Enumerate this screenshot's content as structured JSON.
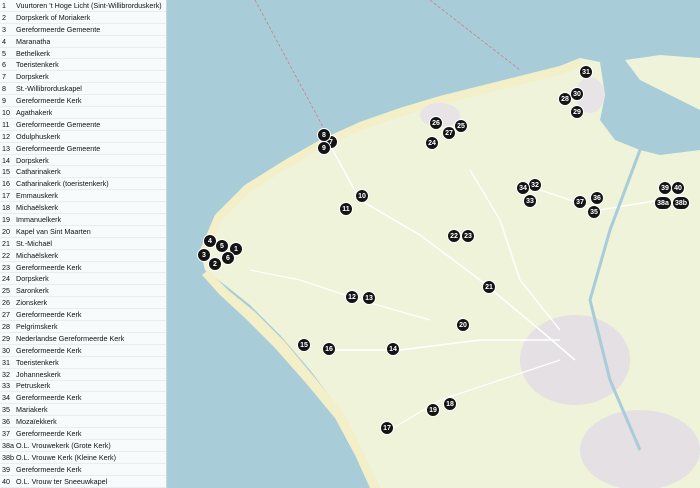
{
  "legend": [
    {
      "num": "1",
      "name": "Vuurtoren 't Hoge Licht (Sint-Willibrorduskerk)"
    },
    {
      "num": "2",
      "name": "Dorpskerk of Moriakerk"
    },
    {
      "num": "3",
      "name": "Gereformeerde Gemeente"
    },
    {
      "num": "4",
      "name": "Maranatha"
    },
    {
      "num": "5",
      "name": "Bethelkerk"
    },
    {
      "num": "6",
      "name": "Toeristenkerk"
    },
    {
      "num": "7",
      "name": "Dorpskerk"
    },
    {
      "num": "8",
      "name": "St.-Willibrorduskapel"
    },
    {
      "num": "9",
      "name": "Gereformeerde Kerk"
    },
    {
      "num": "10",
      "name": "Agathakerk"
    },
    {
      "num": "11",
      "name": "Gereformeerde Gemeente"
    },
    {
      "num": "12",
      "name": "Odulphuskerk"
    },
    {
      "num": "13",
      "name": "Gereformeerde Gemeente"
    },
    {
      "num": "14",
      "name": "Dorpskerk"
    },
    {
      "num": "15",
      "name": "Catharinakerk"
    },
    {
      "num": "16",
      "name": "Catharinakerk (toeristenkerk)"
    },
    {
      "num": "17",
      "name": "Emmauskerk"
    },
    {
      "num": "18",
      "name": "Michaëlskerk"
    },
    {
      "num": "19",
      "name": "Immanuelkerk"
    },
    {
      "num": "20",
      "name": "Kapel van Sint Maarten"
    },
    {
      "num": "21",
      "name": "St.-Michaël"
    },
    {
      "num": "22",
      "name": "Michaëlskerk"
    },
    {
      "num": "23",
      "name": "Gereformeerde Kerk"
    },
    {
      "num": "24",
      "name": "Dorpskerk"
    },
    {
      "num": "25",
      "name": "Saronkerk"
    },
    {
      "num": "26",
      "name": "Zionskerk"
    },
    {
      "num": "27",
      "name": "Gereformeerde Kerk"
    },
    {
      "num": "28",
      "name": "Pelgrimskerk"
    },
    {
      "num": "29",
      "name": "Nederlandse Gereformeerde Kerk"
    },
    {
      "num": "30",
      "name": "Gereformeerde Kerk"
    },
    {
      "num": "31",
      "name": "Toeristenkerk"
    },
    {
      "num": "32",
      "name": "Johanneskerk"
    },
    {
      "num": "33",
      "name": "Petruskerk"
    },
    {
      "num": "34",
      "name": "Gereformeerde Kerk"
    },
    {
      "num": "35",
      "name": "Mariakerk"
    },
    {
      "num": "36",
      "name": "Mozaïekkerk"
    },
    {
      "num": "37",
      "name": "Gereformeerde Kerk"
    },
    {
      "num": "38a",
      "name": "O.L. Vrouwekerk (Grote Kerk)"
    },
    {
      "num": "38b",
      "name": "O.L. Vrouwe Kerk (Kleine Kerk)"
    },
    {
      "num": "39",
      "name": "Gereformeerde Kerk"
    },
    {
      "num": "40",
      "name": "O.L. Vrouw ter Sneeuwkapel"
    }
  ],
  "markers": [
    "1",
    "2",
    "3",
    "4",
    "5",
    "6",
    "7",
    "8",
    "9",
    "10",
    "11",
    "12",
    "13",
    "14",
    "15",
    "16",
    "17",
    "18",
    "19",
    "20",
    "21",
    "22",
    "23",
    "24",
    "25",
    "26",
    "27",
    "28",
    "29",
    "30",
    "31",
    "32",
    "33",
    "34",
    "35",
    "36",
    "37",
    "38a",
    "38b",
    "39",
    "40"
  ],
  "colors": {
    "sea": "#a8ccd8",
    "land": "#eef3d9",
    "marker": "#141414"
  }
}
